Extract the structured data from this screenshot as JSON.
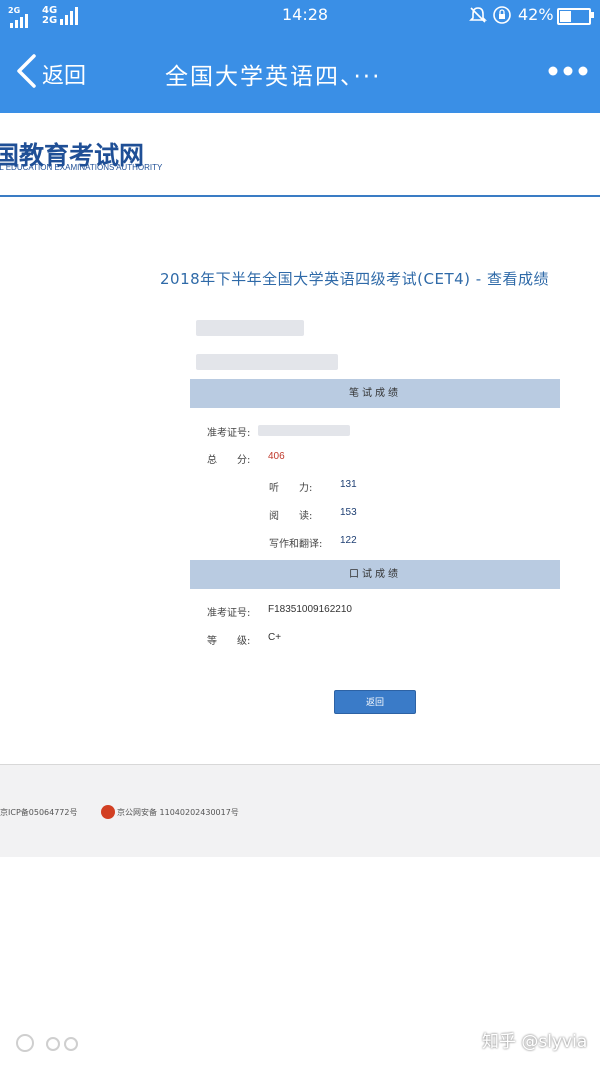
{
  "status_bar": {
    "signal_left": "2G",
    "signal_right_top": "4G",
    "signal_right_bottom": "2G",
    "time": "14:28",
    "battery_percent": "42%",
    "battery_level": 0.42,
    "icons": [
      "signal-bars-icon",
      "bell-off-icon",
      "rotation-lock-icon",
      "battery-icon"
    ]
  },
  "navbar": {
    "back_label": "返回",
    "title": "全国大学英语四、···",
    "color": "#3a8fe6"
  },
  "site": {
    "logo_cn": "国教育考试网",
    "logo_en": "AL EDUCATION EXAMINATIONS AUTHORITY"
  },
  "exam": {
    "title": "2018年下半年全国大学英语四级考试(CET4) - 查看成绩"
  },
  "written": {
    "header": "笔试成绩",
    "ticket_label": "准考证号:",
    "total_label": "总　　分:",
    "total_value": "406",
    "listening_label": "听　　力:",
    "listening_value": "131",
    "reading_label": "阅　　读:",
    "reading_value": "153",
    "writing_label": "写作和翻译:",
    "writing_value": "122"
  },
  "oral": {
    "header": "口试成绩",
    "ticket_label": "准考证号:",
    "ticket_value": "F18351009162210",
    "grade_label": "等　　级:",
    "grade_value": "C+"
  },
  "back_button": "返回",
  "footer": {
    "icp": "京ICP备05064772号",
    "police": "京公网安备 11040202430017号"
  },
  "watermark": {
    "text": "知乎 @slyvia"
  }
}
